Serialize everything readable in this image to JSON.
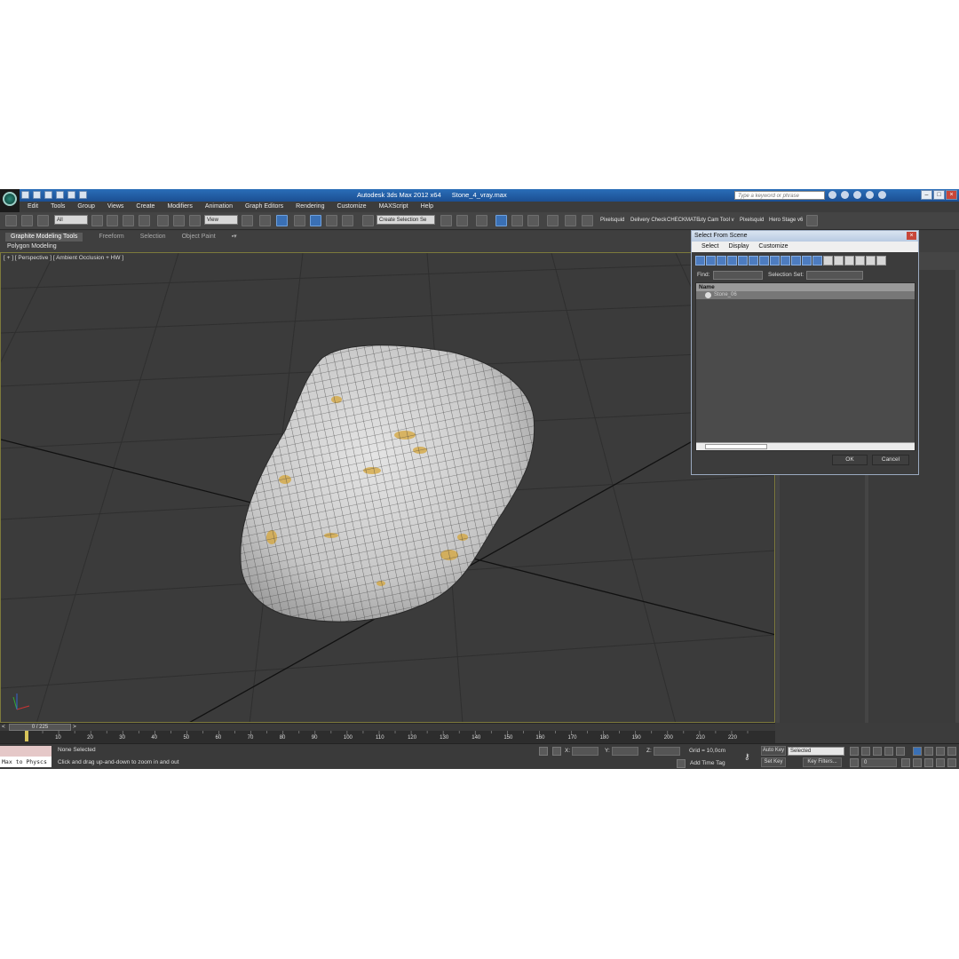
{
  "window": {
    "app_title": "Autodesk 3ds Max  2012 x64",
    "file_name": "Stone_4_vray.max",
    "search_placeholder": "Type a keyword or phrase"
  },
  "menu": [
    "Edit",
    "Tools",
    "Group",
    "Views",
    "Create",
    "Modifiers",
    "Animation",
    "Graph Editors",
    "Rendering",
    "Customize",
    "MAXScript",
    "Help"
  ],
  "toolbar": {
    "filter_value": "All",
    "reference_coord": "View",
    "selection_set_placeholder": "Create Selection Se",
    "plugins": [
      "Pixelsquid",
      "Delivery Check",
      "CHECKMATE",
      "uty Cam Tool v",
      "Pixelsquid",
      "Hero Stage v6"
    ]
  },
  "ribbon": {
    "tabs": [
      "Graphite Modeling Tools",
      "Freeform",
      "Selection",
      "Object Paint"
    ],
    "active_tab": "Graphite Modeling Tools",
    "panel_label": "Polygon Modeling"
  },
  "viewport": {
    "label": "[ + ] [ Perspective ] [ Ambient Occlusion + HW ]"
  },
  "dialog": {
    "title": "Select From Scene",
    "menu": [
      "Select",
      "Display",
      "Customize"
    ],
    "find_label": "Find:",
    "selection_set_label": "Selection Set:",
    "column_header": "Name",
    "items": [
      "Stone_06"
    ],
    "ok_label": "OK",
    "cancel_label": "Cancel"
  },
  "timeline": {
    "frame_display": "0 / 225",
    "current_frame": 0,
    "total_frames": 225,
    "ticks": [
      "10",
      "20",
      "30",
      "40",
      "50",
      "60",
      "70",
      "80",
      "90",
      "100",
      "110",
      "120",
      "130",
      "140",
      "150",
      "160",
      "170",
      "180",
      "190",
      "200",
      "210",
      "220"
    ]
  },
  "status": {
    "maxscript_text": "Max to Physcs",
    "selection_status": "None Selected",
    "prompt": "Click and drag up-and-down to zoom in and out",
    "x_label": "X:",
    "y_label": "Y:",
    "z_label": "Z:",
    "grid": "Grid = 10,0cm",
    "add_time_tag": "Add Time Tag",
    "auto_key": "Auto Key",
    "key_mode_value": "Selected",
    "set_key": "Set Key",
    "key_filters": "Key Filters...",
    "frame_spinner": "0"
  },
  "colors": {
    "title_bar": "#1b4f92",
    "viewport_bg": "#3b3b3b",
    "viewport_border": "#7d7a3c",
    "stone_base": "#cfcfcf",
    "stone_lichen": "#d6a63a"
  }
}
